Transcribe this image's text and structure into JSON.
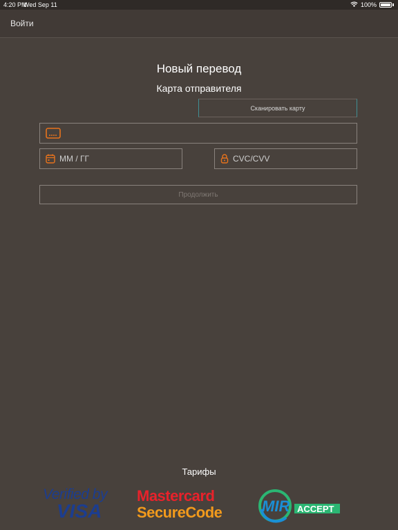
{
  "status_bar": {
    "time": "4:20 PM",
    "date": "Wed Sep 11",
    "battery": "100%"
  },
  "nav": {
    "login_label": "Войти"
  },
  "form": {
    "title": "Новый перевод",
    "subtitle": "Карта отправителя",
    "scan_label": "Сканировать карту",
    "card_number_value": "",
    "card_number_placeholder": "",
    "expiry_value": "",
    "expiry_placeholder": "ММ / ГГ",
    "cvc_value": "",
    "cvc_placeholder": "CVC/CVV",
    "continue_label": "Продолжить"
  },
  "footer": {
    "tariffs_label": "Тарифы",
    "visa_line1": "Verified by",
    "visa_line2": "VISA",
    "mastercard_line1": "Mastercard",
    "mastercard_line2": "SecureCode",
    "mir_text": "MIR",
    "mir_accept": "ACCEPT"
  },
  "colors": {
    "background": "#48413c",
    "accent_orange": "#e8731c",
    "scan_border": "#3f8f95",
    "visa_blue": "#1c3d8f",
    "mastercard_red": "#e8222b",
    "mastercard_orange": "#f29a1c",
    "mir_green": "#2bb673",
    "mir_blue": "#1a8fd6"
  },
  "icons": {
    "card": "credit-card-icon",
    "calendar": "calendar-icon",
    "lock": "lock-icon",
    "wifi": "wifi-icon",
    "battery": "battery-icon"
  }
}
